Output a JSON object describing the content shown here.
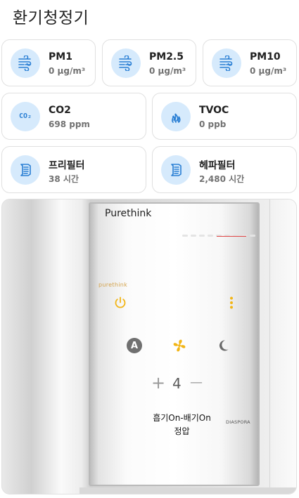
{
  "page": {
    "title": "환기청정기"
  },
  "sensors": {
    "pm1": {
      "label": "PM1",
      "value": "0 µg/m³",
      "icon": "airwaves-icon"
    },
    "pm25": {
      "label": "PM2.5",
      "value": "0 µg/m³",
      "icon": "airwaves-icon"
    },
    "pm10": {
      "label": "PM10",
      "value": "0 µg/m³",
      "icon": "airwaves-icon"
    },
    "co2": {
      "label": "CO2",
      "value": "698 ppm",
      "icon": "co2-icon"
    },
    "tvoc": {
      "label": "TVOC",
      "value": "0 ppb",
      "icon": "flame-icon"
    }
  },
  "filters": {
    "pre": {
      "label": "프리필터",
      "value": "38 시간",
      "icon": "filter-icon"
    },
    "hepa": {
      "label": "헤파필터",
      "value": "2,480 시간",
      "icon": "filter-icon"
    }
  },
  "device": {
    "brand_top": "Purethink",
    "brand_small": "purethink",
    "maker": "DIASPORA",
    "co2_icon_text": "CO₂",
    "auto_button_letter": "A",
    "speed_plus": "+",
    "speed_value": "4",
    "speed_minus": "—",
    "mode_line1": "흡기On-배기On",
    "mode_line2": "정압"
  },
  "colors": {
    "icon_bg": "#d6eafc",
    "icon_blue": "#2a7fd4",
    "accent_yellow": "#f2b516",
    "card_border": "#e0e0e0"
  }
}
